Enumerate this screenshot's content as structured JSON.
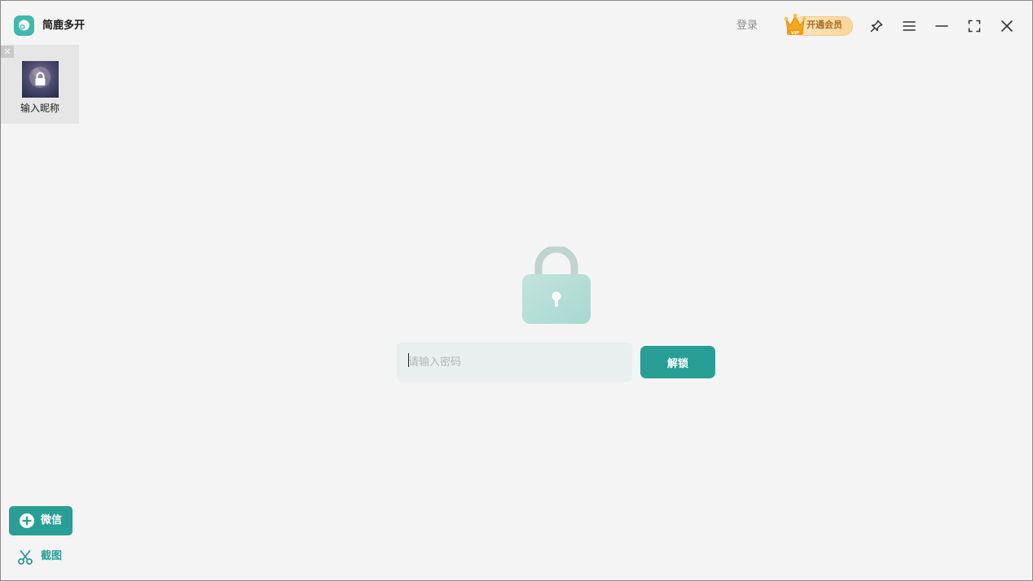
{
  "app": {
    "title": "简鹿多开",
    "login_label": "登录",
    "vip_label": "开通会员",
    "vip_badge": "VIP"
  },
  "title_icons": [
    "app-logo-icon",
    "crown-icon",
    "pin-icon",
    "menu-icon",
    "minimize-icon",
    "maximize-icon",
    "close-icon"
  ],
  "sidebar": {
    "accounts": [
      {
        "name": "输入昵称",
        "locked": true
      }
    ],
    "add_button_label": "微信",
    "screenshot_label": "截图"
  },
  "lock_screen": {
    "password_placeholder": "请输入密码",
    "password_value": "",
    "unlock_label": "解锁"
  },
  "colors": {
    "accent": "#289e95",
    "background": "#f4f4f4",
    "vip_gold": "#fbd599"
  }
}
